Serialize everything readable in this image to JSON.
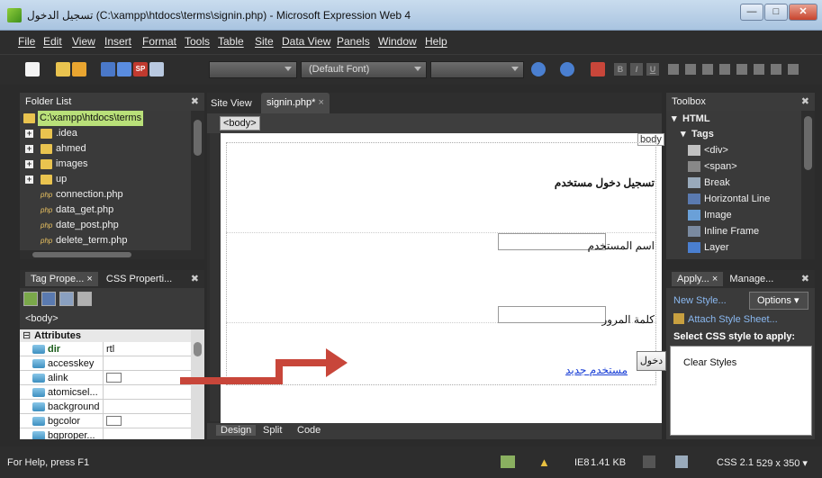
{
  "window": {
    "title": "تسجيل الدخول (C:\\xampp\\htdocs\\terms\\signin.php) - Microsoft Expression Web 4",
    "min_label": "—",
    "max_label": "□",
    "close_label": "✕"
  },
  "menu": [
    "File",
    "Edit",
    "View",
    "Insert",
    "Format",
    "Tools",
    "Table",
    "Site",
    "Data View",
    "Panels",
    "Window",
    "Help"
  ],
  "toolbar": {
    "style_dropdown": "",
    "font_dropdown": "(Default Font)",
    "size_dropdown": "",
    "format_buttons": [
      "B",
      "I",
      "U"
    ]
  },
  "folder_list": {
    "title": "Folder List",
    "root": "C:\\xampp\\htdocs\\terms",
    "items": [
      {
        "name": ".idea",
        "type": "folder"
      },
      {
        "name": "ahmed",
        "type": "folder"
      },
      {
        "name": "images",
        "type": "folder"
      },
      {
        "name": "up",
        "type": "folder"
      },
      {
        "name": "connection.php",
        "type": "php"
      },
      {
        "name": "data_get.php",
        "type": "php"
      },
      {
        "name": "date_post.php",
        "type": "php"
      },
      {
        "name": "delete_term.php",
        "type": "php"
      }
    ]
  },
  "tag_properties": {
    "tab1": "Tag Prope...",
    "tab2": "CSS Properti...",
    "current_tag": "<body>",
    "section": "Attributes",
    "rows": [
      {
        "name": "dir",
        "value": "rtl",
        "bold": true
      },
      {
        "name": "accesskey",
        "value": ""
      },
      {
        "name": "alink",
        "value": "",
        "color": true
      },
      {
        "name": "atomicsel...",
        "value": ""
      },
      {
        "name": "background",
        "value": ""
      },
      {
        "name": "bgcolor",
        "value": "",
        "color": true
      },
      {
        "name": "bgproper...",
        "value": ""
      }
    ]
  },
  "editor": {
    "tab_site": "Site View",
    "tab_file": "signin.php*",
    "tab_close": "×",
    "breadcrumb": "<body>",
    "body_label": "body",
    "heading": "تسجيل دخول مستخدم",
    "username_label": "اسم المستخدم",
    "password_label": "كلمة المرور",
    "login_button": "دخول",
    "new_user_link": "مستخدم جديد",
    "view_tabs": [
      "Design",
      "Split",
      "Code"
    ]
  },
  "toolbox": {
    "title": "Toolbox",
    "section": "HTML",
    "subsection": "Tags",
    "items": [
      "<div>",
      "<span>",
      "Break",
      "Horizontal Line",
      "Image",
      "Inline Frame",
      "Layer"
    ]
  },
  "apply_styles": {
    "tab1": "Apply...",
    "tab2": "Manage...",
    "new_style": "New Style...",
    "options": "Options",
    "attach": "Attach Style Sheet...",
    "select_label": "Select CSS style to apply:",
    "clear": "Clear Styles"
  },
  "status": {
    "help": "For Help, press F1",
    "browser": "IE8",
    "size": "1.41 KB",
    "css": "CSS 2.1",
    "dimensions": "529 x 350"
  },
  "colors": {
    "accent_arrow": "#c8463a",
    "link": "#1a3fd6",
    "root_highlight": "#b9e079"
  }
}
